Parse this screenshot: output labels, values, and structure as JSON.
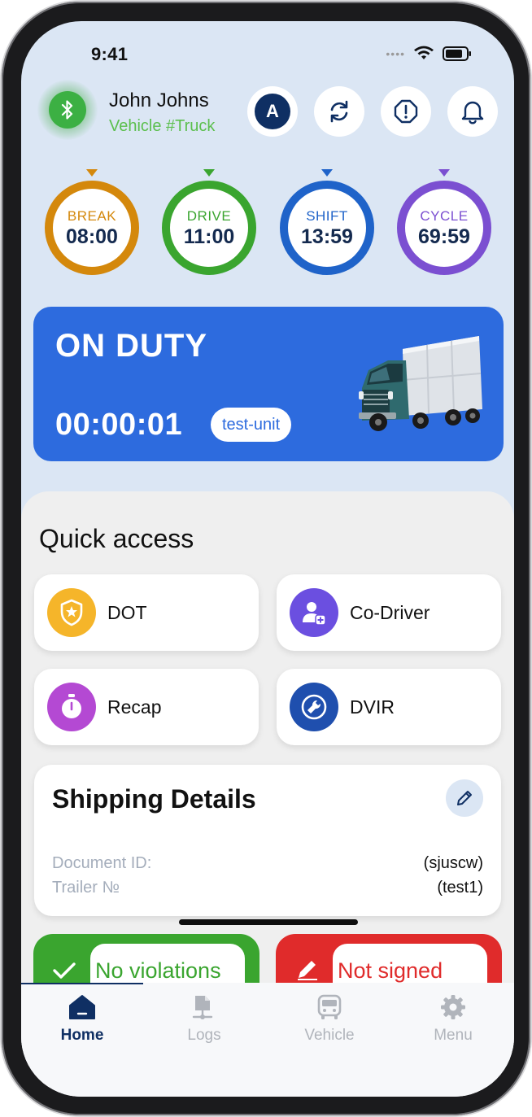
{
  "status_bar": {
    "time": "9:41"
  },
  "header": {
    "driver_name": "John Johns",
    "vehicle": "Vehicle #Truck",
    "avatar_letter": "A"
  },
  "timers": [
    {
      "label": "BREAK",
      "value": "08:00",
      "color": "#d4880c"
    },
    {
      "label": "DRIVE",
      "value": "11:00",
      "color": "#3aa52f"
    },
    {
      "label": "SHIFT",
      "value": "13:59",
      "color": "#1f63c9"
    },
    {
      "label": "CYCLE",
      "value": "69:59",
      "color": "#7b4fd1"
    }
  ],
  "duty": {
    "status": "ON DUTY",
    "elapsed": "00:00:01",
    "unit": "test-unit",
    "card_color": "#2d6bde"
  },
  "quick_access": {
    "title": "Quick access",
    "tiles": [
      {
        "label": "DOT",
        "icon": "shield-star-icon",
        "color": "#f5b52a"
      },
      {
        "label": "Co-Driver",
        "icon": "add-driver-icon",
        "color": "#6b4fe0"
      },
      {
        "label": "Recap",
        "icon": "stopwatch-icon",
        "color": "#b449d3"
      },
      {
        "label": "DVIR",
        "icon": "wrench-icon",
        "color": "#1f4fae"
      }
    ]
  },
  "shipping": {
    "title": "Shipping Details",
    "rows": [
      {
        "key": "Document ID:",
        "value": "(sjuscw)"
      },
      {
        "key": "Trailer №",
        "value": "(test1)"
      }
    ]
  },
  "status_pills": [
    {
      "label": "No violations",
      "color": "#3aa52f",
      "icon": "check-icon"
    },
    {
      "label": "Not signed",
      "color": "#e02b2b",
      "icon": "pen-icon"
    }
  ],
  "tabs": [
    {
      "label": "Home",
      "icon": "home-icon",
      "active": true
    },
    {
      "label": "Logs",
      "icon": "logs-icon",
      "active": false
    },
    {
      "label": "Vehicle",
      "icon": "bus-icon",
      "active": false
    },
    {
      "label": "Menu",
      "icon": "gear-icon",
      "active": false
    }
  ]
}
